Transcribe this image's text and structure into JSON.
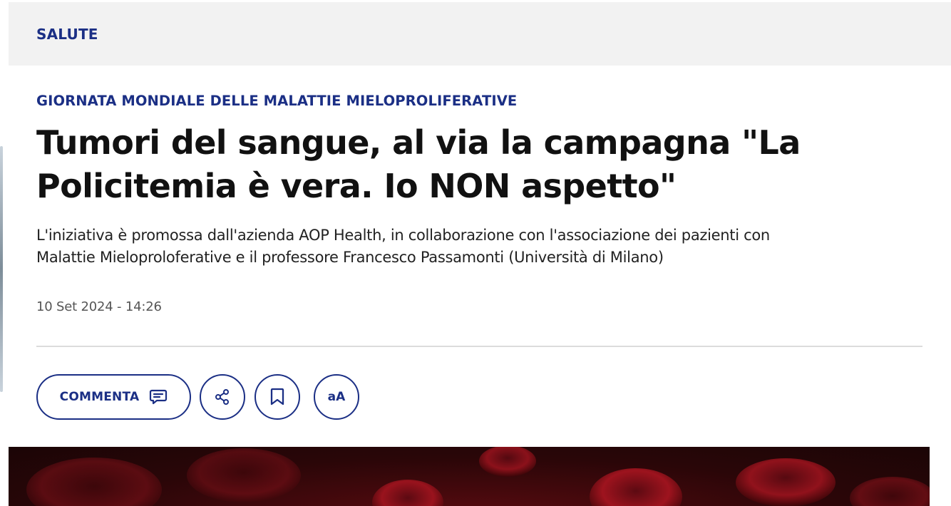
{
  "section": {
    "label": "SALUTE"
  },
  "article": {
    "kicker": "GIORNATA MONDIALE DELLE MALATTIE MIELOPROLIFERATIVE",
    "headline_line1": "Tumori del sangue, al via la campagna \"La",
    "headline_line2": "Policitemia è vera. Io NON aspetto\"",
    "subtitle_line1": "L'iniziativa è promossa dall'azienda AOP Health, in collaborazione con l'associazione dei pazienti con",
    "subtitle_line2": "Malattie Mieloproloferative e il professore Francesco Passamonti (Università di Milano)",
    "date": "10 Set 2024 - 14:26"
  },
  "actions": {
    "comment_label": "COMMENTA",
    "comment_icon": "comment-icon",
    "share_icon": "share-icon",
    "bookmark_icon": "bookmark-icon",
    "font_size_label": "aA"
  },
  "colors": {
    "brand_blue": "#1b2f85",
    "headline": "#111111",
    "section_bar_bg": "#f2f2f2"
  }
}
